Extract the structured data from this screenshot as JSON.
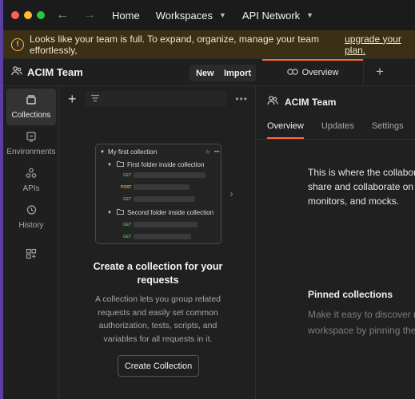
{
  "topbar": {
    "home": "Home",
    "workspaces": "Workspaces",
    "api_network": "API Network"
  },
  "banner": {
    "text": "Looks like your team is full. To expand, organize, manage your team effortlessly,",
    "link": "upgrade your plan."
  },
  "workspace": {
    "title": "ACIM Team",
    "new_label": "New",
    "import_label": "Import"
  },
  "rail": [
    {
      "label": "Collections",
      "icon": "collections-icon"
    },
    {
      "label": "Environments",
      "icon": "environments-icon"
    },
    {
      "label": "APIs",
      "icon": "apis-icon"
    },
    {
      "label": "History",
      "icon": "history-icon"
    }
  ],
  "illustration": {
    "collection": "My first collection",
    "folder1": "First folder inside collection",
    "folder2": "Second folder inside collection",
    "get": "GET",
    "post": "POST"
  },
  "empty": {
    "title_line1": "Create a collection for your",
    "title_line2": "requests",
    "desc_line1": "A collection lets you group related",
    "desc_line2": "requests and easily set common",
    "desc_line3": "authorization, tests, scripts, and",
    "desc_line4": "variables for all requests in it.",
    "button": "Create Collection"
  },
  "right": {
    "tab": "Overview",
    "title": "ACIM Team",
    "tabs": [
      "Overview",
      "Updates",
      "Settings"
    ],
    "body_line1": "This is where the collabor",
    "body_line2": "share and collaborate on",
    "body_line3": "monitors, and mocks.",
    "pinned_title": "Pinned collections",
    "pinned_line1": "Make it easy to discover r",
    "pinned_line2": "workspace by pinning the"
  },
  "colors": {
    "accent": "#ff6c37",
    "banner_bg": "#3b2f16",
    "get": "#4caf50",
    "post": "#e2a23b"
  }
}
